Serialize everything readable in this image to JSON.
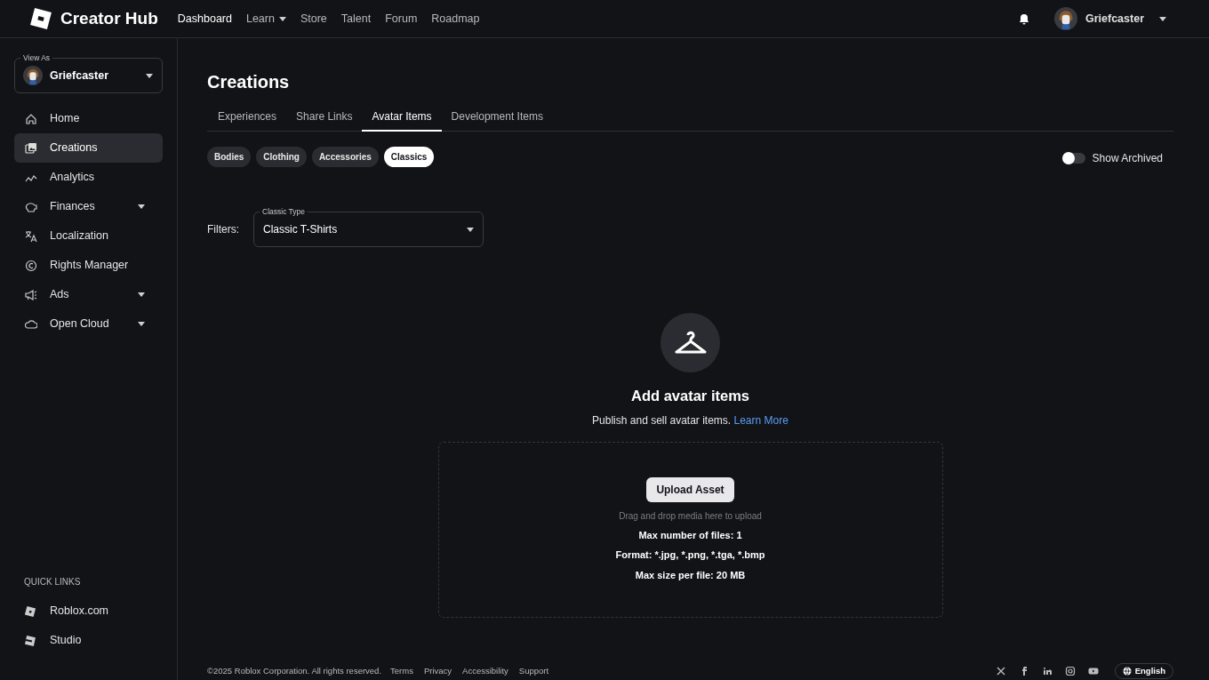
{
  "header": {
    "brand": "Creator Hub",
    "nav": [
      {
        "label": "Dashboard",
        "selected": true,
        "dropdown": false
      },
      {
        "label": "Learn",
        "selected": false,
        "dropdown": true
      },
      {
        "label": "Store",
        "selected": false,
        "dropdown": false
      },
      {
        "label": "Talent",
        "selected": false,
        "dropdown": false
      },
      {
        "label": "Forum",
        "selected": false,
        "dropdown": false
      },
      {
        "label": "Roadmap",
        "selected": false,
        "dropdown": false
      }
    ],
    "user": "Griefcaster"
  },
  "sidebar": {
    "view_as": {
      "label": "View As",
      "value": "Griefcaster"
    },
    "items": [
      {
        "label": "Home",
        "selected": false,
        "dropdown": false
      },
      {
        "label": "Creations",
        "selected": true,
        "dropdown": false
      },
      {
        "label": "Analytics",
        "selected": false,
        "dropdown": false
      },
      {
        "label": "Finances",
        "selected": false,
        "dropdown": true
      },
      {
        "label": "Localization",
        "selected": false,
        "dropdown": false
      },
      {
        "label": "Rights Manager",
        "selected": false,
        "dropdown": false
      },
      {
        "label": "Ads",
        "selected": false,
        "dropdown": true
      },
      {
        "label": "Open Cloud",
        "selected": false,
        "dropdown": true
      }
    ],
    "quick_links": {
      "title": "QUICK LINKS",
      "items": [
        {
          "label": "Roblox.com"
        },
        {
          "label": "Studio"
        }
      ]
    }
  },
  "page": {
    "title": "Creations",
    "tabs": [
      {
        "label": "Experiences",
        "selected": false
      },
      {
        "label": "Share Links",
        "selected": false
      },
      {
        "label": "Avatar Items",
        "selected": true
      },
      {
        "label": "Development Items",
        "selected": false
      }
    ],
    "chips": [
      {
        "label": "Bodies",
        "selected": false
      },
      {
        "label": "Clothing",
        "selected": false
      },
      {
        "label": "Accessories",
        "selected": false
      },
      {
        "label": "Classics",
        "selected": true
      }
    ],
    "show_archived": {
      "label": "Show Archived",
      "on": false
    },
    "filters": {
      "label": "Filters:",
      "select": {
        "label": "Classic Type",
        "value": "Classic T-Shirts"
      }
    },
    "empty_state": {
      "title": "Add avatar items",
      "text": "Publish and sell avatar items.",
      "link": "Learn More"
    },
    "upload": {
      "button": "Upload Asset",
      "hint": "Drag and drop media here to upload",
      "rules": [
        "Max number of files: 1",
        "Format: *.jpg, *.png, *.tga, *.bmp",
        "Max size per file: 20 MB"
      ]
    }
  },
  "footer": {
    "copyright": "©2025 Roblox Corporation. All rights reserved.",
    "links": [
      "Terms",
      "Privacy",
      "Accessibility",
      "Support"
    ],
    "language": "English"
  }
}
